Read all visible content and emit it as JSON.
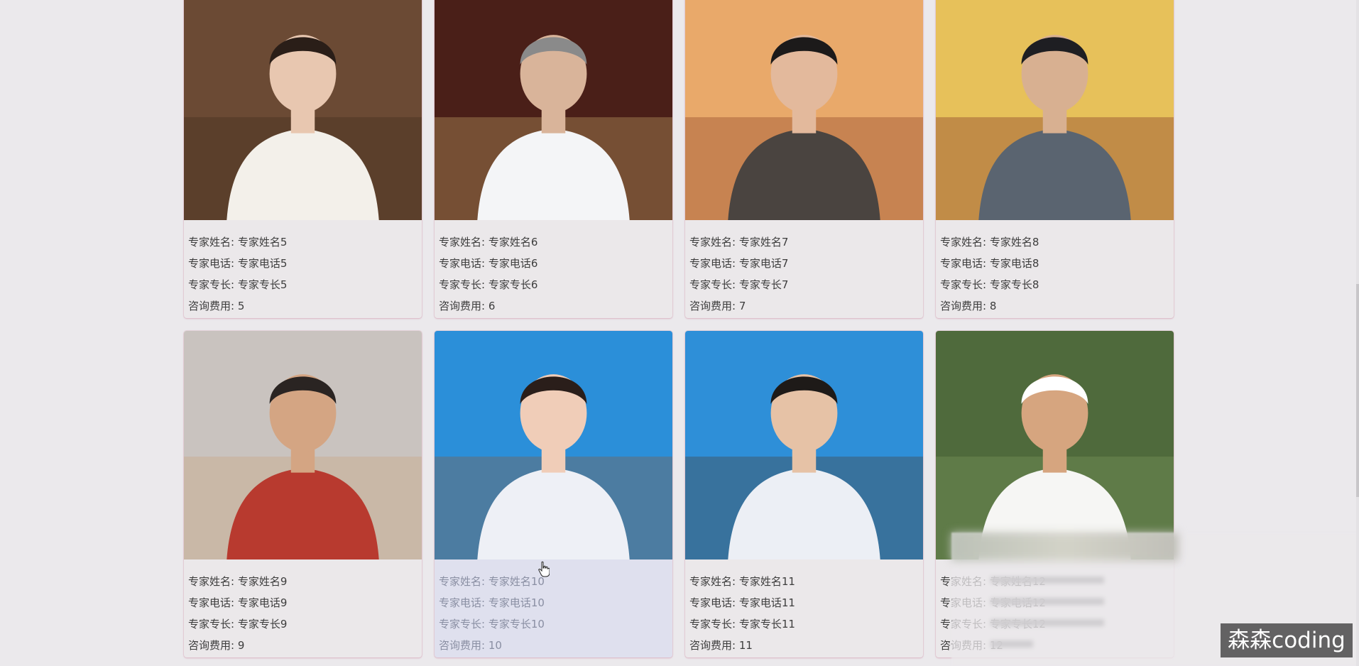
{
  "labels": {
    "name": "专家姓名",
    "phone": "专家电话",
    "specialty": "专家专长",
    "fee": "咨询费用"
  },
  "cards": [
    {
      "name": "专家姓名5",
      "phone": "专家电话5",
      "specialty": "专家专长5",
      "fee": "5",
      "colors": {
        "bg": "#6b4a34",
        "accent": "#3e2a1e",
        "face": "#e8c7b0",
        "cloth": "#f3f0ea",
        "hair": "#2a1e18"
      }
    },
    {
      "name": "专家姓名6",
      "phone": "专家电话6",
      "specialty": "专家专长6",
      "fee": "6",
      "colors": {
        "bg": "#4a1f18",
        "accent": "#c9a86a",
        "face": "#d9b49a",
        "cloth": "#f4f5f7",
        "hair": "#8a8a8a"
      }
    },
    {
      "name": "专家姓名7",
      "phone": "专家电话7",
      "specialty": "专家专长7",
      "fee": "7",
      "colors": {
        "bg": "#e9a96a",
        "accent": "#8a3b22",
        "face": "#e3b99c",
        "cloth": "#4a4440",
        "hair": "#1c1a1a"
      }
    },
    {
      "name": "专家姓名8",
      "phone": "专家电话8",
      "specialty": "专家专长8",
      "fee": "8",
      "colors": {
        "bg": "#e7c15a",
        "accent": "#7b2a24",
        "face": "#d8b091",
        "cloth": "#5a6470",
        "hair": "#1e1e22"
      }
    },
    {
      "name": "专家姓名9",
      "phone": "专家电话9",
      "specialty": "专家专长9",
      "fee": "9",
      "colors": {
        "bg": "#c9c3bf",
        "accent": "#c9a27a",
        "face": "#d4a583",
        "cloth": "#b83a2f",
        "hair": "#2a2422"
      }
    },
    {
      "name": "专家姓名10",
      "phone": "专家电话10",
      "specialty": "专家专长10",
      "fee": "10",
      "colors": {
        "bg": "#2b8fd9",
        "accent": "#8a5a3a",
        "face": "#f0cdb8",
        "cloth": "#eef0f6",
        "hair": "#2a1e1a"
      }
    },
    {
      "name": "专家姓名11",
      "phone": "专家电话11",
      "specialty": "专家专长11",
      "fee": "11",
      "colors": {
        "bg": "#2e8fd8",
        "accent": "#4a3c30",
        "face": "#e6c2a6",
        "cloth": "#eceff5",
        "hair": "#1e1a18"
      }
    },
    {
      "name": "专家姓名12",
      "phone": "专家电话12",
      "specialty": "专家专长12",
      "fee": "12",
      "colors": {
        "bg": "#4f6a3c",
        "accent": "#7d9a5e",
        "face": "#d6a57f",
        "cloth": "#f6f6f4",
        "hair": "#ffffff"
      }
    }
  ],
  "watermark": "森森coding"
}
